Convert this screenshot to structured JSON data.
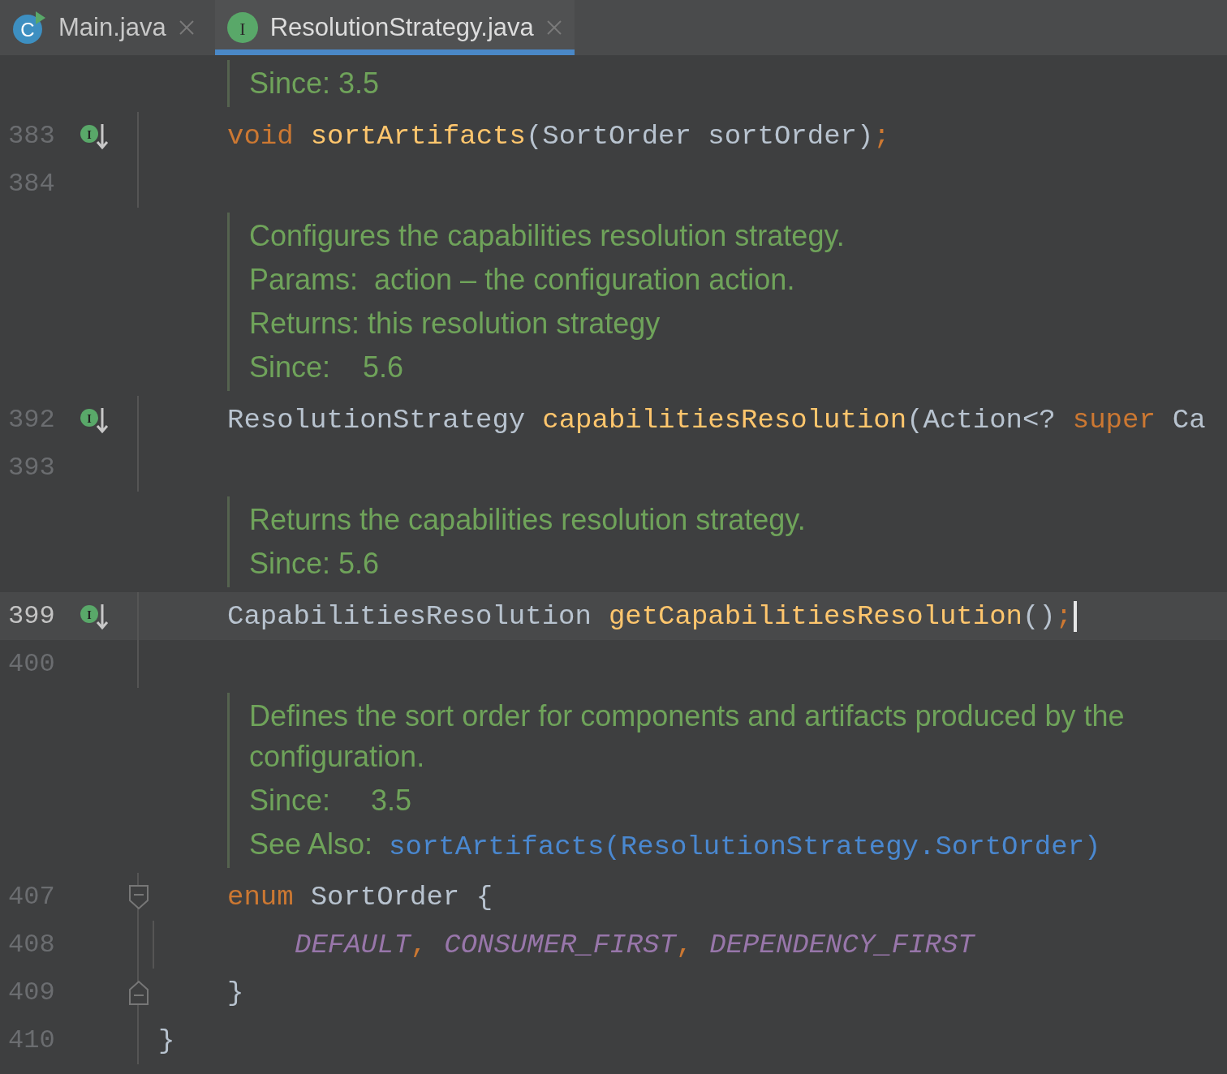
{
  "tabs": [
    {
      "label": "Main.java",
      "icon": {
        "kind": "class",
        "letter": "C"
      },
      "selected": false
    },
    {
      "label": "ResolutionStrategy.java",
      "icon": {
        "kind": "interface",
        "letter": "I"
      },
      "selected": true
    }
  ],
  "editor": {
    "blocks": [
      {
        "kind": "doc",
        "lines": [
          [
            {
              "kind": "text",
              "text": "Since: 3.5"
            }
          ]
        ]
      },
      {
        "kind": "member",
        "number": "383",
        "gutter": {
          "kind": "implemented",
          "letter": "I"
        },
        "current": false,
        "tokens": [
          {
            "kind": "keyword",
            "text": "void"
          },
          {
            "kind": "function",
            "text": "sortArtifacts"
          },
          {
            "kind": "plain",
            "text": "(SortOrder sortOrder)"
          },
          {
            "kind": "punct",
            "text": ";"
          }
        ]
      },
      {
        "kind": "member",
        "number": "384",
        "current": false
      },
      {
        "kind": "doc",
        "lines": [
          [
            {
              "kind": "text",
              "text": "Configures the capabilities resolution strategy."
            }
          ],
          [
            {
              "kind": "text",
              "text": "Params:"
            },
            {
              "kind": "text",
              "text": "action – the configuration action."
            }
          ],
          [
            {
              "kind": "text",
              "text": "Returns: this resolution strategy"
            }
          ],
          [
            {
              "kind": "text",
              "text": "Since:"
            },
            {
              "kind": "text",
              "text": "  5.6"
            }
          ]
        ]
      },
      {
        "kind": "member",
        "number": "392",
        "gutter": {
          "kind": "implemented",
          "letter": "I"
        },
        "current": false,
        "tokens": [
          {
            "kind": "plain",
            "text": "ResolutionStrategy"
          },
          {
            "kind": "function",
            "text": "capabilitiesResolution"
          },
          {
            "kind": "plain",
            "text": "(Action<?"
          },
          {
            "kind": "keyword",
            "text": "super"
          },
          {
            "kind": "plain",
            "text": "Ca"
          }
        ]
      },
      {
        "kind": "member",
        "number": "393",
        "current": false
      },
      {
        "kind": "doc",
        "lines": [
          [
            {
              "kind": "text",
              "text": "Returns the capabilities resolution strategy."
            }
          ],
          [
            {
              "kind": "text",
              "text": "Since: 5.6"
            }
          ]
        ]
      },
      {
        "kind": "member",
        "number": "399",
        "gutter": {
          "kind": "implemented",
          "letter": "I"
        },
        "current": true,
        "tokens": [
          {
            "kind": "plain",
            "text": "CapabilitiesResolution"
          },
          {
            "kind": "function",
            "text": "getCapabilitiesResolution"
          },
          {
            "kind": "plain",
            "text": "()"
          },
          {
            "kind": "punct",
            "text": ";"
          }
        ]
      },
      {
        "kind": "member",
        "number": "400",
        "current": false
      },
      {
        "kind": "doc",
        "lines": [
          [
            {
              "kind": "text",
              "text": "Defines the sort order for components and artifacts produced by the configuration."
            }
          ],
          [
            {
              "kind": "text",
              "text": "Since:"
            },
            {
              "kind": "text",
              "text": "   3.5"
            }
          ],
          [
            {
              "kind": "text",
              "text": "See Also:"
            },
            {
              "kind": "link",
              "text": "sortArtifacts(ResolutionStrategy.SortOrder)"
            }
          ]
        ]
      },
      {
        "kind": "member",
        "number": "407",
        "gutter": {
          "kind": "fold-start"
        },
        "current": false,
        "tokens": [
          {
            "kind": "keyword",
            "text": "enum"
          },
          {
            "kind": "plain",
            "text": "SortOrder {"
          }
        ]
      },
      {
        "kind": "enum-constant",
        "number": "408",
        "current": false,
        "tokens": [
          {
            "kind": "constant",
            "text": "DEFAULT"
          },
          {
            "kind": "punct",
            "text": ","
          },
          {
            "kind": "constant",
            "text": "CONSUMER_FIRST"
          },
          {
            "kind": "punct",
            "text": ","
          },
          {
            "kind": "constant",
            "text": "DEPENDENCY_FIRST"
          }
        ]
      },
      {
        "kind": "member",
        "number": "409",
        "gutter": {
          "kind": "fold-end"
        },
        "current": false,
        "tokens": [
          {
            "kind": "plain",
            "text": "}"
          }
        ]
      },
      {
        "kind": "type-end",
        "number": "410",
        "current": false,
        "tokens": [
          {
            "kind": "plain",
            "text": "}"
          }
        ]
      }
    ]
  }
}
